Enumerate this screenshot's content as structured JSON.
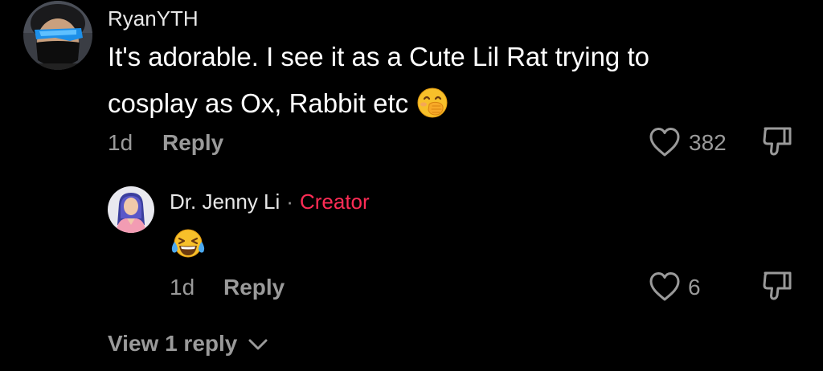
{
  "comment": {
    "username": "RyanYTH",
    "text_line1": "It's adorable. I see it as a Cute Lil Rat trying to",
    "text_line2": "cosplay as Ox, Rabbit etc",
    "emoji_icon": "hand-over-mouth-emoji",
    "timestamp": "1d",
    "reply_label": "Reply",
    "like_count": "382"
  },
  "reply": {
    "username": "Dr. Jenny Li",
    "separator": "·",
    "badge": "Creator",
    "emoji_icon": "tears-of-joy-emoji",
    "timestamp": "1d",
    "reply_label": "Reply",
    "like_count": "6"
  },
  "view_replies": {
    "label": "View 1 reply"
  },
  "colors": {
    "background": "#000000",
    "text_primary": "#ffffff",
    "text_secondary": "#9a9a9a",
    "creator_accent": "#fe2c55"
  }
}
